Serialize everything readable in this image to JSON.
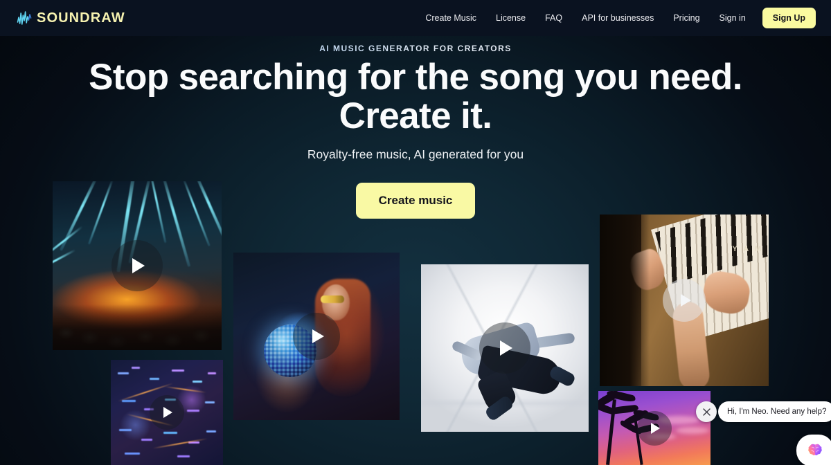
{
  "header": {
    "logo_text": "SOUNDRAW",
    "logo_icon": "soundwave-icon",
    "nav": [
      {
        "label": "Create Music",
        "name": "nav-create-music"
      },
      {
        "label": "License",
        "name": "nav-license"
      },
      {
        "label": "FAQ",
        "name": "nav-faq"
      },
      {
        "label": "API for businesses",
        "name": "nav-api-for-businesses"
      },
      {
        "label": "Pricing",
        "name": "nav-pricing"
      },
      {
        "label": "Sign in",
        "name": "nav-sign-in"
      }
    ],
    "signup_label": "Sign Up",
    "signup_bg": "#fafaa0",
    "bar_bg": "#0a1220"
  },
  "hero": {
    "eyebrow": "AI MUSIC GENERATOR FOR CREATORS",
    "headline_line1": "Stop searching for the song you need.",
    "headline_line2": "Create it.",
    "subheadline": "Royalty-free music, AI generated for you",
    "cta_label": "Create music",
    "cta_bg": "#f9f9a4",
    "bg_color": "#0f2734"
  },
  "cards": [
    {
      "name": "video-card-concert-lasers",
      "alt": "Concert stage with blue laser beams and orange lights over a crowd",
      "play_icon": "play-icon"
    },
    {
      "name": "video-card-disco-ball",
      "alt": "Woman with sunglasses holding a glowing disco ball",
      "play_icon": "play-icon"
    },
    {
      "name": "video-card-breakdancer",
      "alt": "Breakdancer mid-freeze in a bright white corridor",
      "play_icon": "play-icon"
    },
    {
      "name": "video-card-piano",
      "alt": "Hands playing a wooden Yamaha upright piano",
      "play_icon": "play-icon",
      "brand_text": "Y A M"
    },
    {
      "name": "video-card-night-city",
      "alt": "Aerial night view of a neon-lit city",
      "play_icon": "play-icon"
    },
    {
      "name": "video-card-sunset-palms",
      "alt": "Palm trees silhouetted against a purple and pink sunset",
      "play_icon": "play-icon"
    }
  ],
  "chat": {
    "message": "Hi, I'm Neo. Need any help?",
    "close_icon": "close-icon",
    "launcher_icon": "brain-icon"
  }
}
